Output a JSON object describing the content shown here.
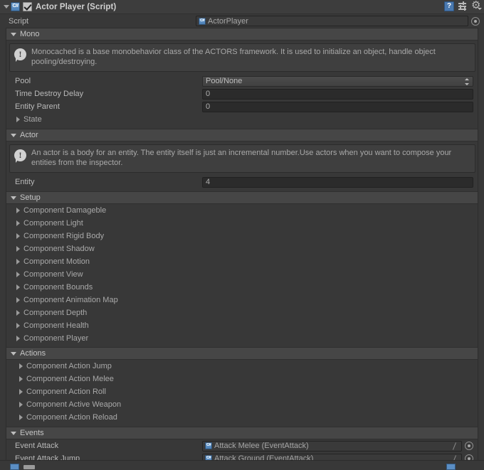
{
  "component_header": {
    "title": "Actor Player (Script)",
    "enabled": true,
    "icons": {
      "help": "help-book-icon",
      "preset": "preset-icon",
      "gear": "gear-icon"
    }
  },
  "script_row": {
    "label": "Script",
    "value": "ActorPlayer"
  },
  "sections": {
    "mono": {
      "title": "Mono",
      "help": "Monocached is a base monobehavior class of the ACTORS framework. It is used to initialize an object, handle object pooling/destroying.",
      "fields": {
        "pool": {
          "label": "Pool",
          "value": "Pool/None"
        },
        "time_destroy_delay": {
          "label": "Time Destroy Delay",
          "value": "0"
        },
        "entity_parent": {
          "label": "Entity Parent",
          "value": "0"
        }
      },
      "state_foldout": "State"
    },
    "actor": {
      "title": "Actor",
      "help": "An actor is a body for an entity. The entity itself is just an incremental number.Use actors when you want to compose your entities from the inspector.",
      "fields": {
        "entity": {
          "label": "Entity",
          "value": "4"
        }
      }
    },
    "setup": {
      "title": "Setup",
      "components": [
        "Component Damageble",
        "Component Light",
        "Component Rigid Body",
        "Component Shadow",
        "Component Motion",
        "Component View",
        "Component Bounds",
        "Component Animation Map",
        "Component Depth",
        "Component Health",
        "Component Player"
      ]
    },
    "actions": {
      "title": "Actions",
      "components": [
        "Component Action Jump",
        "Component Action Melee",
        "Component Action Roll",
        "Component Active Weapon",
        "Component Action Reload"
      ]
    },
    "events": {
      "title": "Events",
      "fields": [
        {
          "label": "Event Attack",
          "value": "Attack Melee (EventAttack)"
        },
        {
          "label": "Event Attack Jump",
          "value": "Attack Ground (EventAttack)"
        }
      ]
    }
  },
  "colors": {
    "background": "#383838",
    "section_header": "#464646",
    "accent_blue": "#4a79b0",
    "text": "#b4b4b4"
  }
}
